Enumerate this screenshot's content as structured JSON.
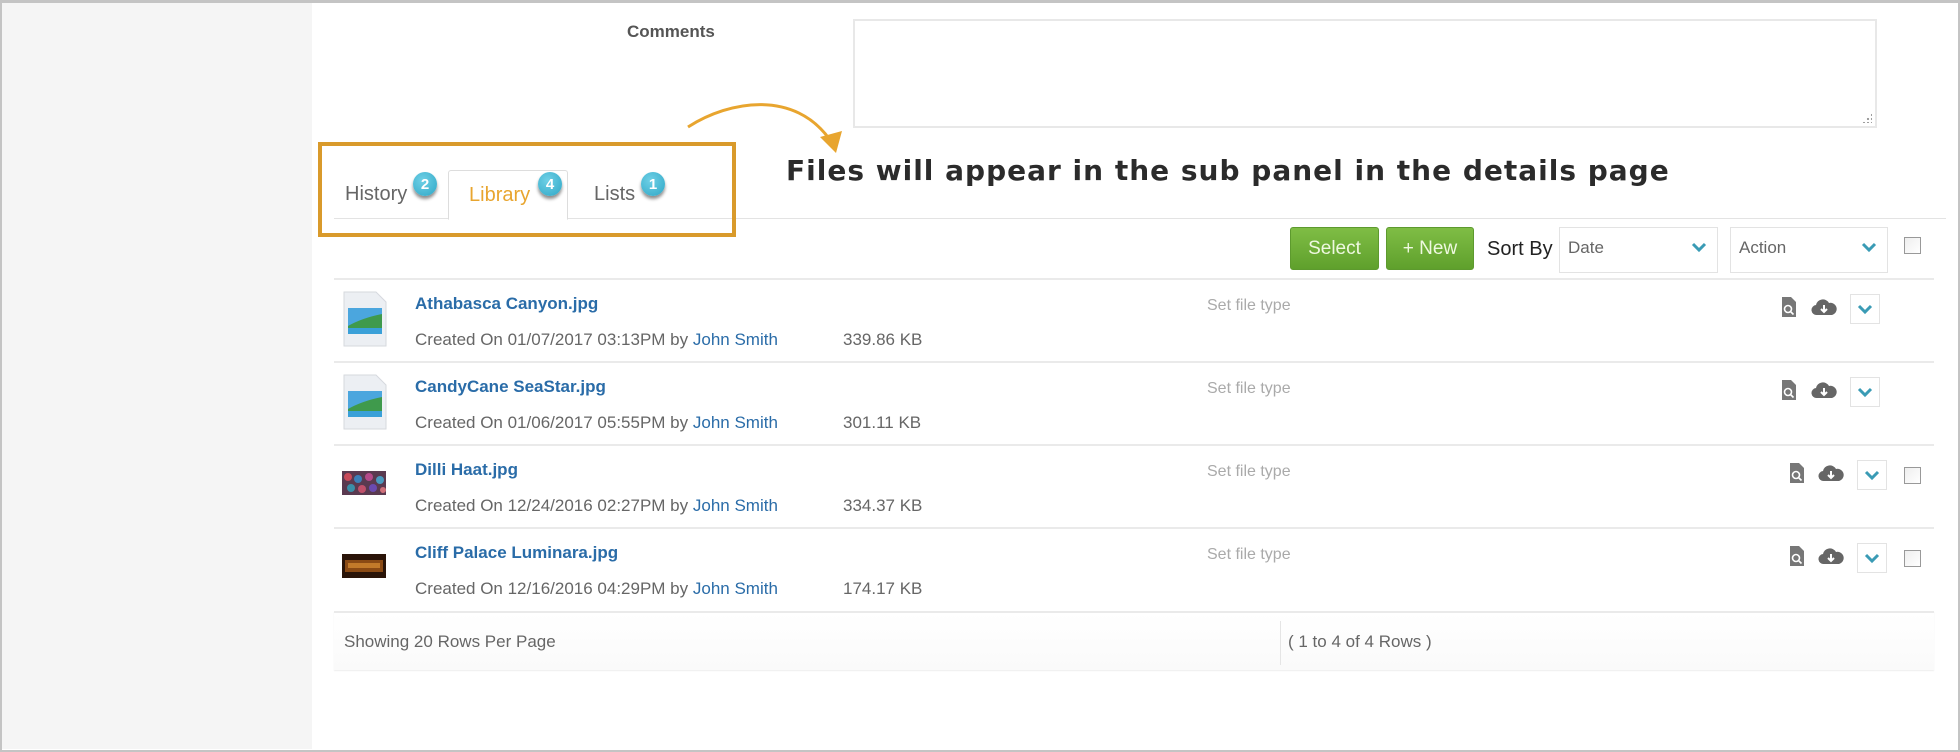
{
  "form": {
    "comments_label": "Comments",
    "comments_value": ""
  },
  "annotation": {
    "text": "Files will appear in the sub panel in the details page",
    "color": "#d99a2b"
  },
  "tabs": [
    {
      "label": "History",
      "count": "2",
      "active": false
    },
    {
      "label": "Library",
      "count": "4",
      "active": true
    },
    {
      "label": "Lists",
      "count": "1",
      "active": false
    }
  ],
  "toolbar": {
    "select_label": "Select",
    "new_label": "+ New",
    "sort_by_label": "Sort By",
    "sort_value": "Date",
    "action_value": "Action"
  },
  "files": [
    {
      "name": "Athabasca Canyon.jpg",
      "created_prefix": "Created On 01/07/2017 03:13PM by",
      "user": "John Smith",
      "size": "339.86 KB",
      "file_type": "Set file type",
      "thumb": "generic-image-icon",
      "checkbox": false
    },
    {
      "name": "CandyCane SeaStar.jpg",
      "created_prefix": "Created On 01/06/2017 05:55PM by",
      "user": "John Smith",
      "size": "301.11 KB",
      "file_type": "Set file type",
      "thumb": "generic-image-icon",
      "checkbox": false
    },
    {
      "name": "Dilli Haat.jpg",
      "created_prefix": "Created On 12/24/2016 02:27PM by",
      "user": "John Smith",
      "size": "334.37 KB",
      "file_type": "Set file type",
      "thumb": "photo-thumbnail",
      "checkbox": true
    },
    {
      "name": "Cliff Palace Luminara.jpg",
      "created_prefix": "Created On 12/16/2016 04:29PM by",
      "user": "John Smith",
      "size": "174.17 KB",
      "file_type": "Set file type",
      "thumb": "photo-thumbnail",
      "checkbox": true
    }
  ],
  "footer": {
    "rows_per_page": "Showing 20 Rows Per Page",
    "range": "( 1 to 4 of 4 Rows )"
  },
  "colors": {
    "accent_orange": "#e8a52f",
    "button_green": "#6aab35",
    "link_blue": "#2a6ca8",
    "badge_blue": "#3bb3d3"
  }
}
